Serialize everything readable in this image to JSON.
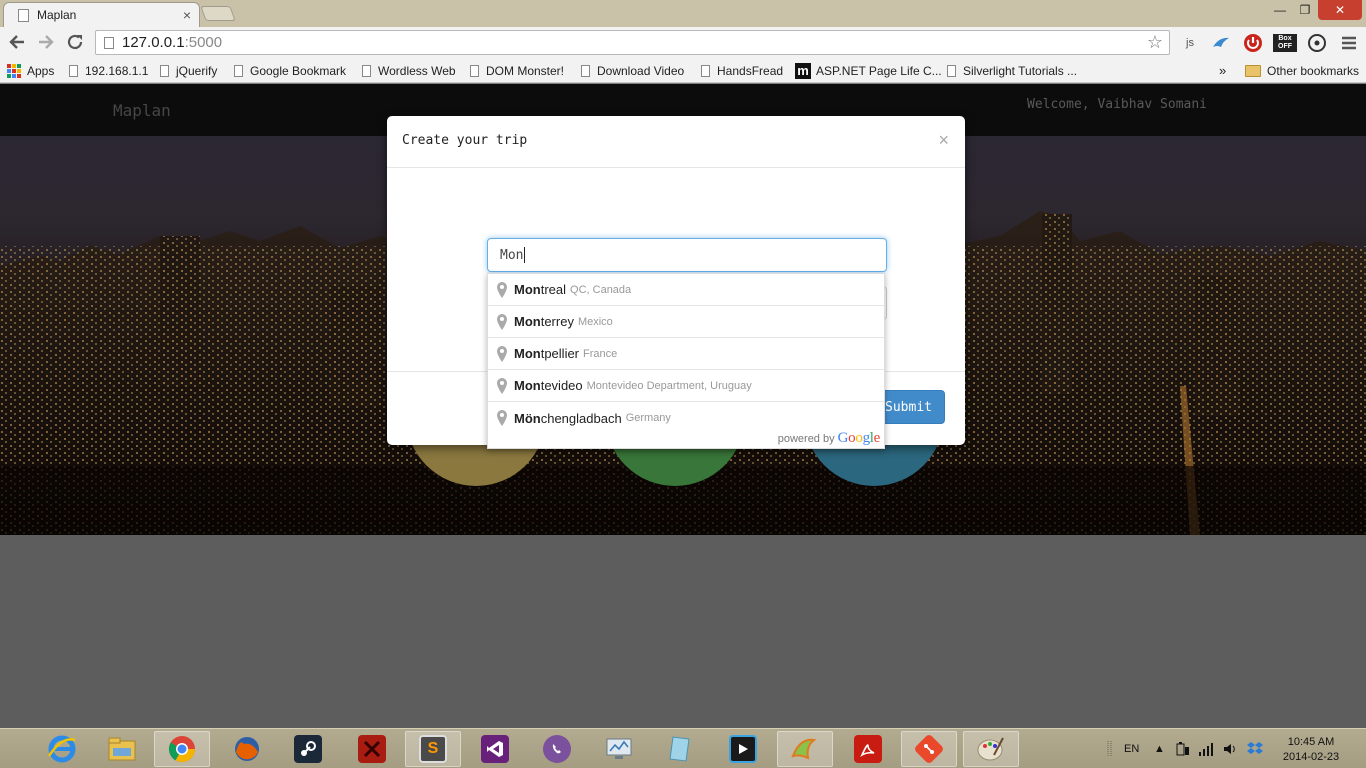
{
  "browser": {
    "tab_title": "Maplan",
    "tab_close": "×",
    "window_minimize": "—",
    "window_maximize": "❐",
    "window_close": "✕",
    "url_host": "127.0.0.1",
    "url_port": ":5000",
    "bookmarks": [
      {
        "label": "Apps"
      },
      {
        "label": "192.168.1.1"
      },
      {
        "label": "jQuerify"
      },
      {
        "label": "Google Bookmark"
      },
      {
        "label": "Wordless Web"
      },
      {
        "label": "DOM Monster!"
      },
      {
        "label": "Download Video"
      },
      {
        "label": "HandsFread"
      },
      {
        "label": "ASP.NET Page Life C..."
      },
      {
        "label": "Silverlight Tutorials ..."
      }
    ],
    "bookmarks_overflow": "»",
    "other_bookmarks": "Other bookmarks",
    "ext_js_label": "js",
    "ext_boxoff_label": "Box OFF"
  },
  "app": {
    "brand": "Maplan",
    "welcome": "Welcome, Vaibhav Somani"
  },
  "modal": {
    "title": "Create your trip",
    "close": "×",
    "search_value": "Mon",
    "submit_label": "Submit"
  },
  "autocomplete": {
    "items": [
      {
        "match": "Mon",
        "rest": "treal",
        "secondary": "QC, Canada"
      },
      {
        "match": "Mon",
        "rest": "terrey",
        "secondary": "Mexico"
      },
      {
        "match": "Mon",
        "rest": "tpellier",
        "secondary": "France"
      },
      {
        "match": "Mon",
        "rest": "tevideo",
        "secondary": "Montevideo Department, Uruguay"
      },
      {
        "match": "Mön",
        "rest": "chengladbach",
        "secondary": "Germany"
      }
    ],
    "powered_by": "powered by",
    "google": "Google"
  },
  "taskbar": {
    "language": "EN",
    "time": "10:45 AM",
    "date": "2014-02-23"
  },
  "colors": {
    "primary_button": "#428bca",
    "navbar": "#101010",
    "circle_1": "#b8a054",
    "circle_2": "#4c9e4c",
    "circle_3": "#3a8aa8"
  }
}
